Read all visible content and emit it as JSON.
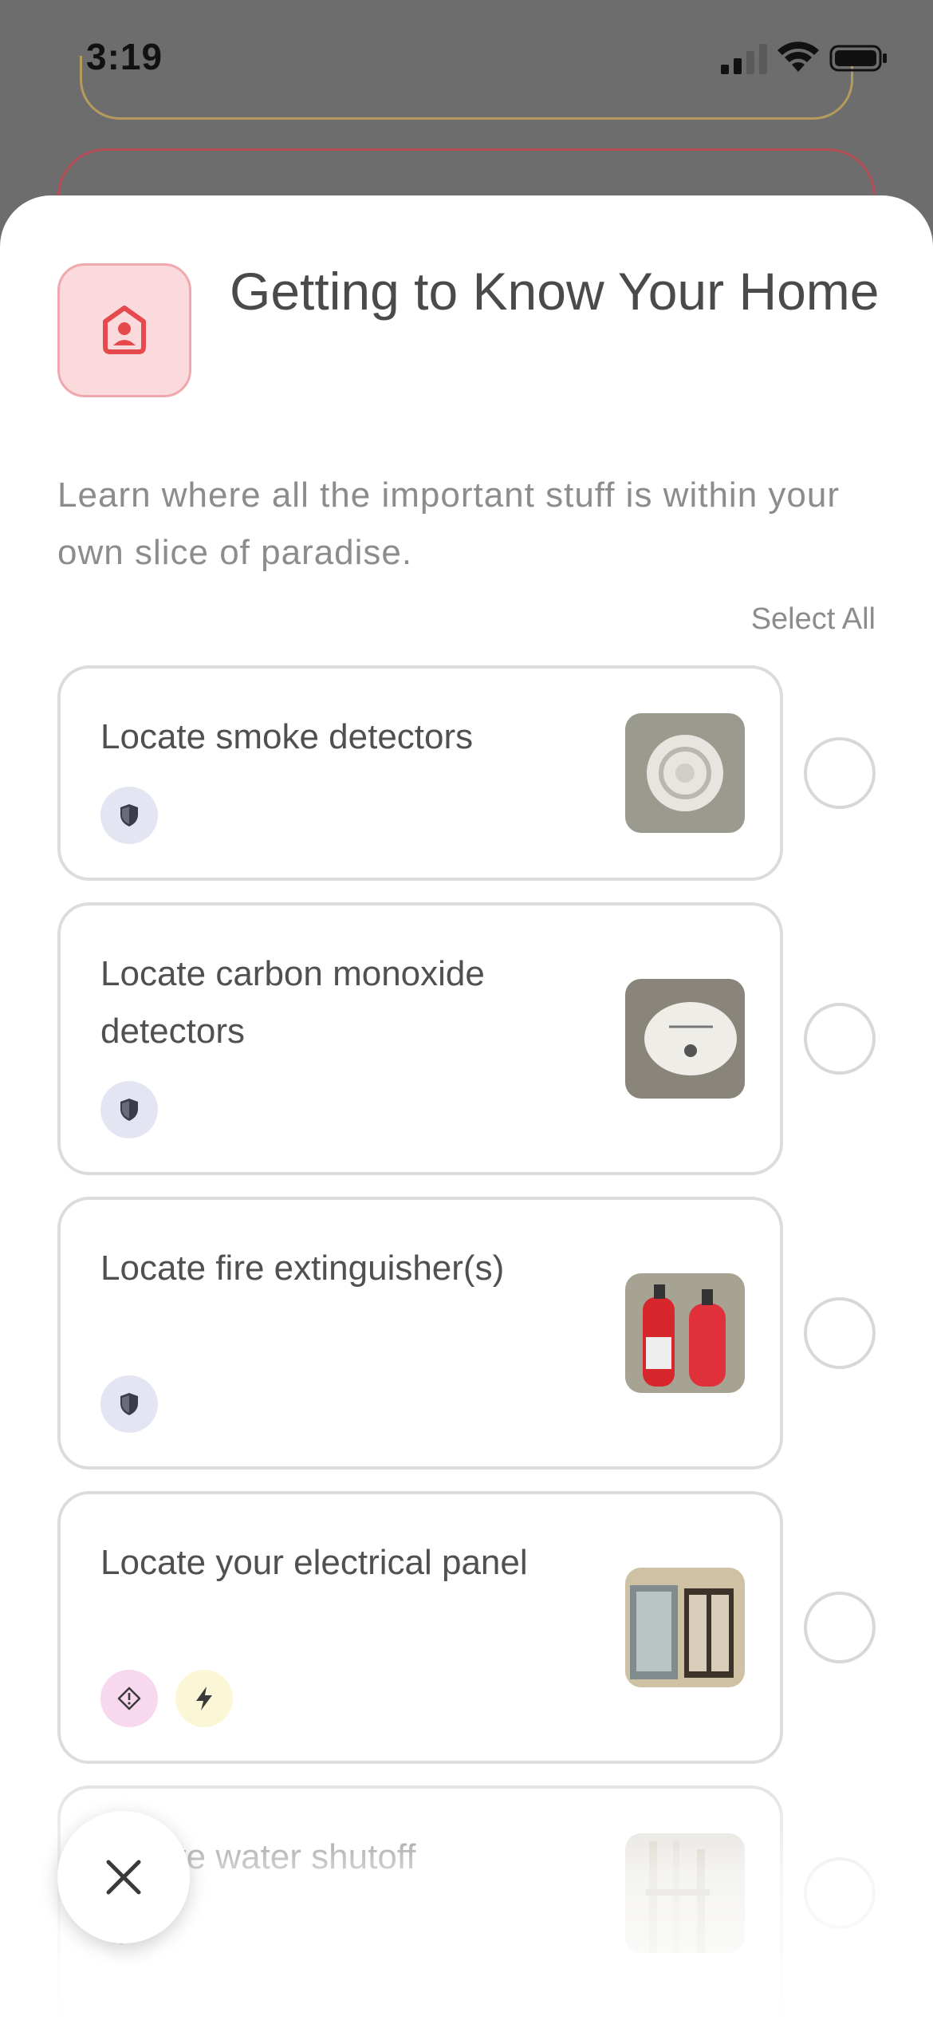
{
  "status_bar": {
    "time": "3:19"
  },
  "header": {
    "title": "Getting to Know Your Home",
    "description": "Learn where all the important stuff is within your own slice of paradise.",
    "icon": "home-person-icon",
    "accent_color": "#e5484d"
  },
  "select_all_label": "Select All",
  "tasks": [
    {
      "label": "Locate smoke detectors",
      "badges": [
        "shield-icon"
      ],
      "thumbnail": "smoke-detector-photo",
      "selected": false
    },
    {
      "label": "Locate carbon monoxide detectors",
      "badges": [
        "shield-icon"
      ],
      "thumbnail": "co-detector-photo",
      "selected": false
    },
    {
      "label": "Locate fire extinguisher(s)",
      "badges": [
        "shield-icon"
      ],
      "thumbnail": "fire-extinguisher-photo",
      "selected": false
    },
    {
      "label": "Locate your electrical panel",
      "badges": [
        "warning-diamond-icon",
        "lightning-icon"
      ],
      "thumbnail": "electrical-panel-photo",
      "selected": false
    },
    {
      "label": "Locate water shutoff",
      "badges": [
        "wrench-icon"
      ],
      "thumbnail": "water-shutoff-photo",
      "selected": false
    }
  ],
  "close_icon": "close-icon"
}
